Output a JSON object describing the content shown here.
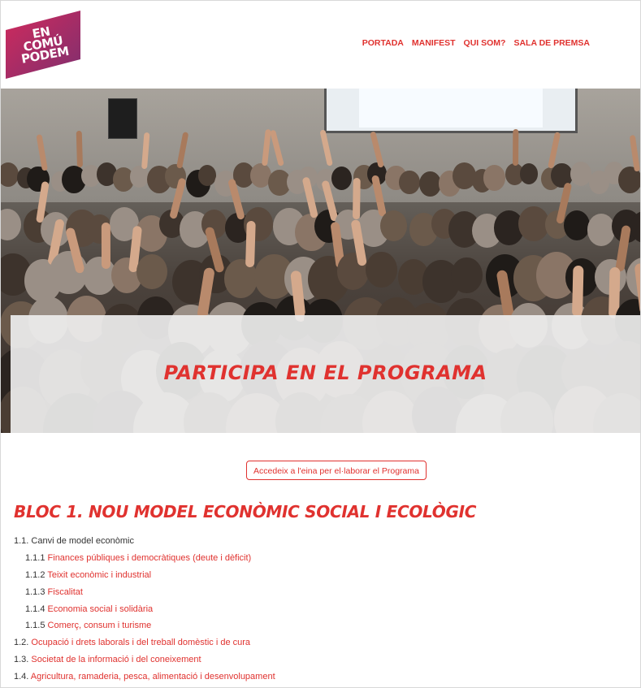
{
  "logo": {
    "alt_lines": [
      "EN",
      "COMÚ",
      "PODEM"
    ]
  },
  "nav": {
    "items": [
      "PORTADA",
      "MANIFEST",
      "QUI SOM?",
      "SALA DE PREMSA"
    ]
  },
  "banner": {
    "title": "PARTICIPA EN EL PROGRAMA"
  },
  "cta": {
    "label": "Accedeix a l'eina per el·laborar el Programa"
  },
  "bloc": {
    "title": "BLOC 1. NOU MODEL ECONÒMIC SOCIAL I ECOLÒGIC"
  },
  "outline": [
    {
      "num": "1.1.",
      "text": "Canvi de model econòmic",
      "link": false,
      "level": 1
    },
    {
      "num": "1.1.1",
      "text": "Finances públiques i democràtiques (deute i dèficit)",
      "link": true,
      "level": 2
    },
    {
      "num": "1.1.2",
      "text": "Teixit econòmic i industrial",
      "link": true,
      "level": 2
    },
    {
      "num": "1.1.3",
      "text": "Fiscalitat",
      "link": true,
      "level": 2
    },
    {
      "num": "1.1.4",
      "text": "Economia social i solidària",
      "link": true,
      "level": 2
    },
    {
      "num": "1.1.5",
      "text": "Comerç, consum i turisme",
      "link": true,
      "level": 2
    },
    {
      "num": "1.2.",
      "text": "Ocupació i drets laborals i del treball domèstic i de cura",
      "link": true,
      "level": 1
    },
    {
      "num": "1.3.",
      "text": "Societat de la informació i del coneixement",
      "link": true,
      "level": 1
    },
    {
      "num": "1.4.",
      "text": "Agricultura, ramaderia, pesca, alimentació i desenvolupament",
      "link": true,
      "level": 1
    }
  ],
  "colors": {
    "accent": "#e0322f",
    "logo_start": "#c0245a",
    "logo_end": "#7a2e6e"
  }
}
